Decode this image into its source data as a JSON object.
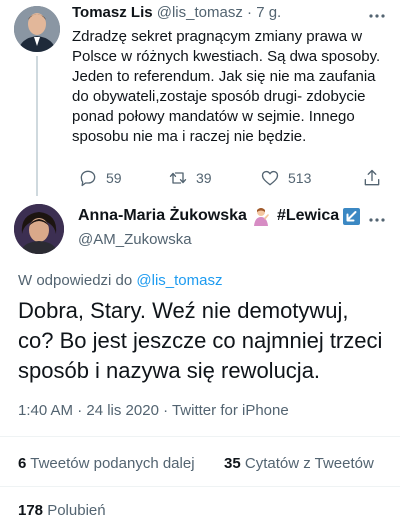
{
  "parent_tweet": {
    "name": "Tomasz Lis",
    "handle": "@lis_tomasz",
    "separator": " · ",
    "time": "7 g.",
    "text": "Zdradzę sekret pragnącym zmiany prawa w Polsce w różnych kwestiach. Są dwa sposoby. Jeden to referendum. Jak się nie ma zaufania do obywateli,zostaje sposób drugi- zdobycie ponad połowy mandatów w sejmie. Innego sposobu nie  ma i raczej nie będzie.",
    "actions": {
      "reply_count": "59",
      "retweet_count": "39",
      "like_count": "513"
    }
  },
  "main_tweet": {
    "name": "Anna-Maria Żukowska",
    "name_tag": "#Lewica",
    "handle": "@AM_Zukowska",
    "reply_prefix": "W odpowiedzi do ",
    "reply_mention": "@lis_tomasz",
    "text": "Dobra, Stary. Weź nie demotywuj, co? Bo jest jeszcze co najmniej trzeci sposób i nazywa się rewolucja.",
    "meta": "1:40 AM · 24 lis 2020 · Twitter for iPhone",
    "stats": {
      "retweets_count": "6",
      "retweets_label": "Tweetów podanych dalej",
      "quotes_count": "35",
      "quotes_label": "Cytatów z Tweetów",
      "likes_count": "178",
      "likes_label": "Polubień"
    }
  },
  "colors": {
    "text": "#0f1419",
    "secondary": "#536471",
    "link": "#1d9bf0",
    "divider": "#eff3f4"
  },
  "icons": [
    "reply-icon",
    "retweet-icon",
    "like-icon",
    "share-icon",
    "more-icon",
    "gesture-emoji-icon",
    "arrow-badge-icon"
  ]
}
